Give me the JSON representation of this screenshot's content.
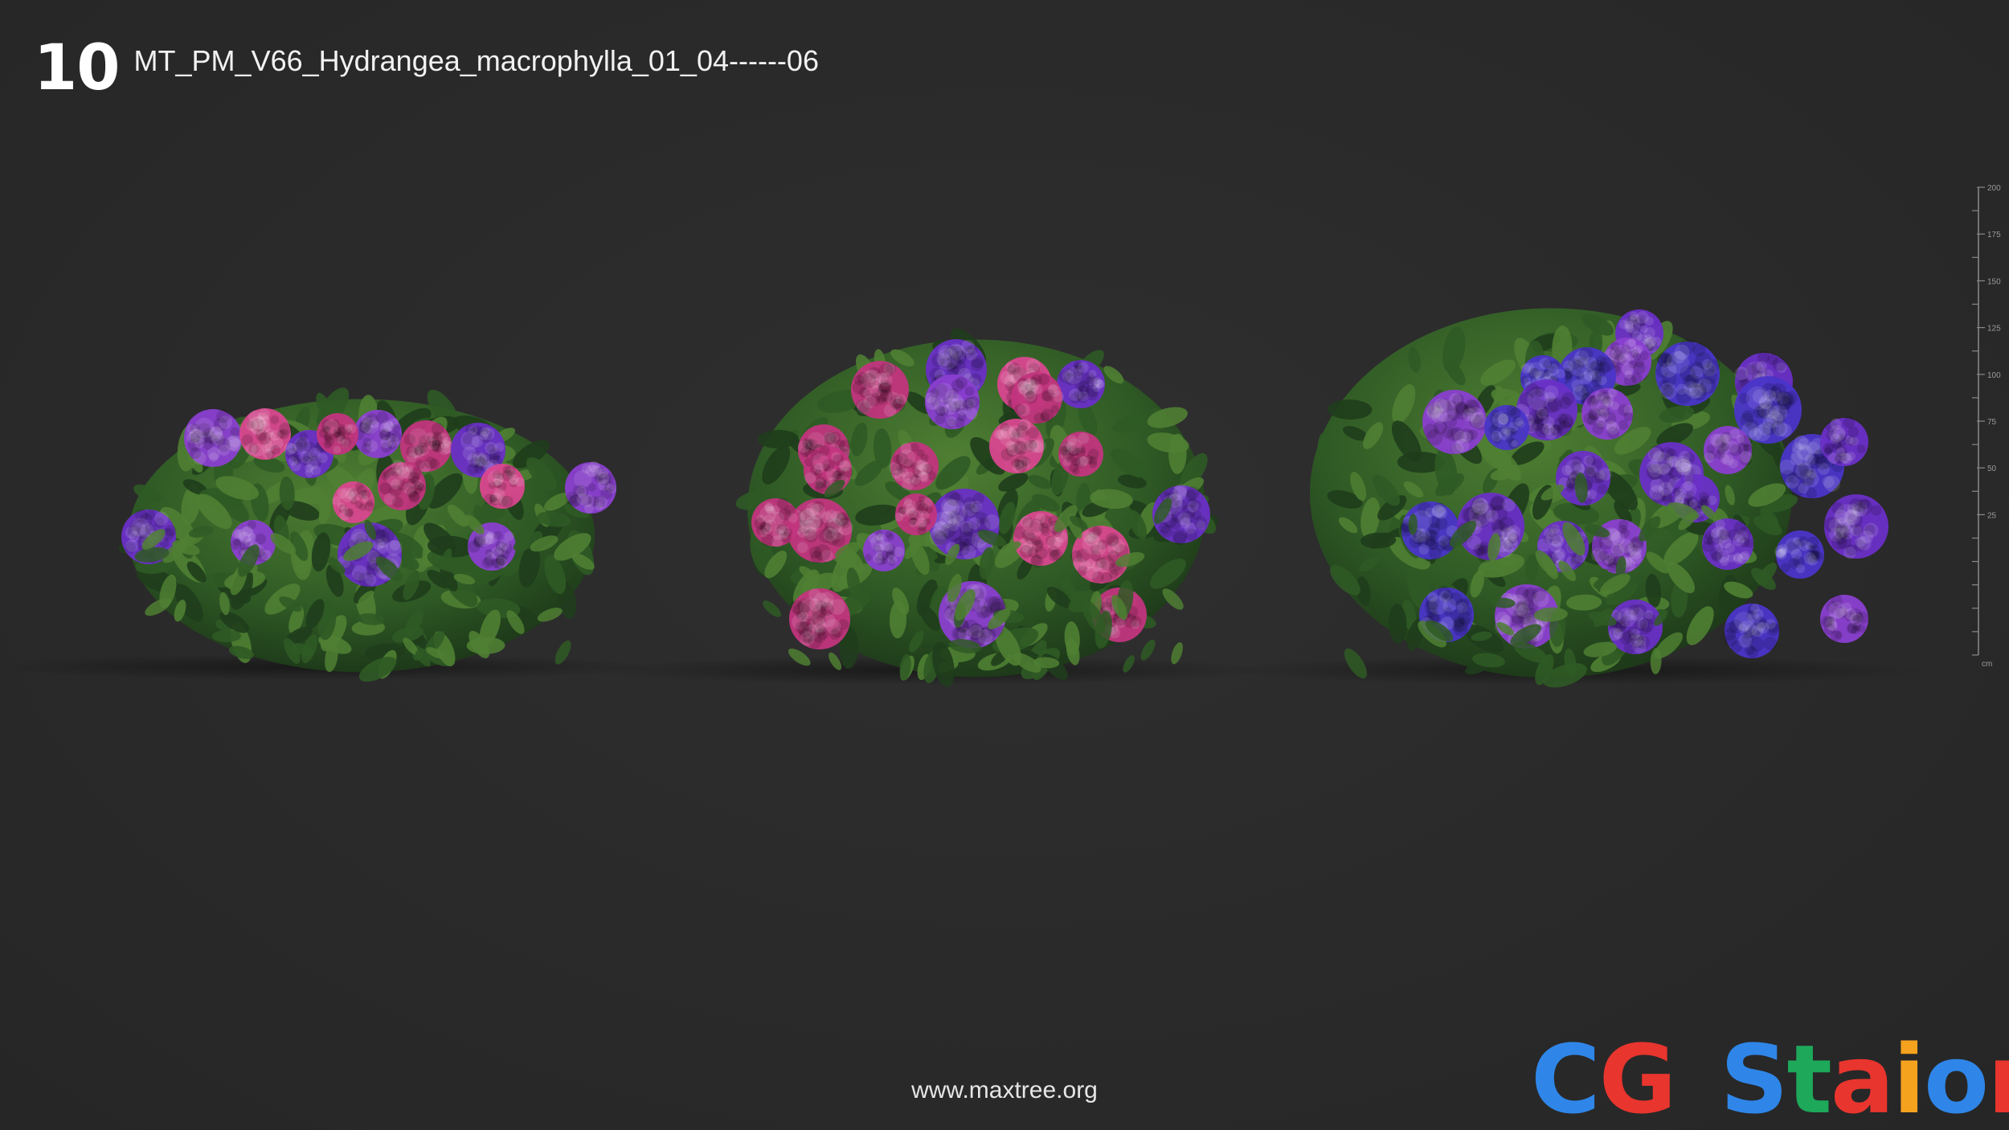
{
  "header": {
    "number": "10",
    "model_name": "MT_PM_V66_Hydrangea_macrophylla_01_04------06"
  },
  "scale": {
    "major_labels": [
      "200",
      "175",
      "150",
      "125",
      "100",
      "75",
      "50",
      "25"
    ],
    "unit": "cm"
  },
  "footer": {
    "url": "www.maxtree.org"
  },
  "watermark": {
    "letters": [
      "C",
      "G",
      "S",
      "t",
      "a",
      "i",
      "o",
      "n"
    ],
    "colors": [
      "#2f86e8",
      "#e8352e",
      "#2f86e8",
      "#1ea85a",
      "#e8352e",
      "#f5a21e",
      "#2f86e8",
      "#e8352e"
    ]
  },
  "colors": {
    "background": "#2b2b2b",
    "leaf_dark": "#1f3d1c",
    "leaf_mid": "#2f5a25",
    "leaf_light": "#4f7f33",
    "bloom_violet": "#8a3fd0",
    "bloom_purple": "#6a2fc7",
    "bloom_magenta": "#c2357e",
    "bloom_pink": "#d9478f",
    "bloom_blue": "#4a35c9"
  }
}
